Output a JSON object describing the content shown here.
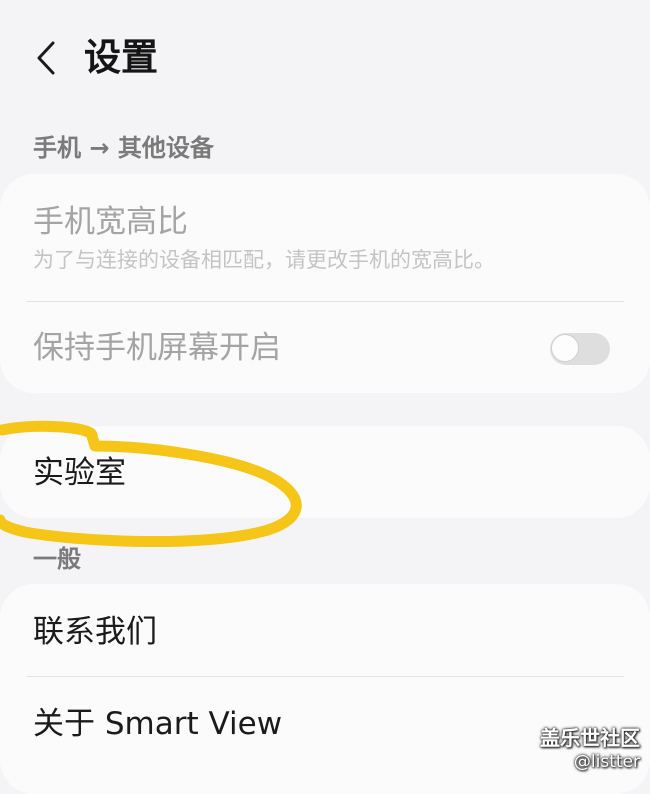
{
  "header": {
    "back_icon": "chevron-left-icon",
    "title": "设置"
  },
  "sections": {
    "phone_to_device": {
      "label": "手机 → 其他设备",
      "aspect_ratio": {
        "title": "手机宽高比",
        "subtitle": "为了与连接的设备相匹配，请更改手机的宽高比。"
      },
      "keep_screen_on": {
        "title": "保持手机屏幕开启",
        "toggle_state": "off"
      }
    },
    "labs": {
      "title": "实验室"
    },
    "general": {
      "label": "一般",
      "contact_us": "联系我们",
      "about": "关于 Smart View"
    }
  },
  "colors": {
    "background": "#f4f4f6",
    "card": "#fbfbfb",
    "highlight_marker": "#f5c518"
  },
  "watermark": {
    "main": "盖乐世社区",
    "sub": "@listter"
  }
}
